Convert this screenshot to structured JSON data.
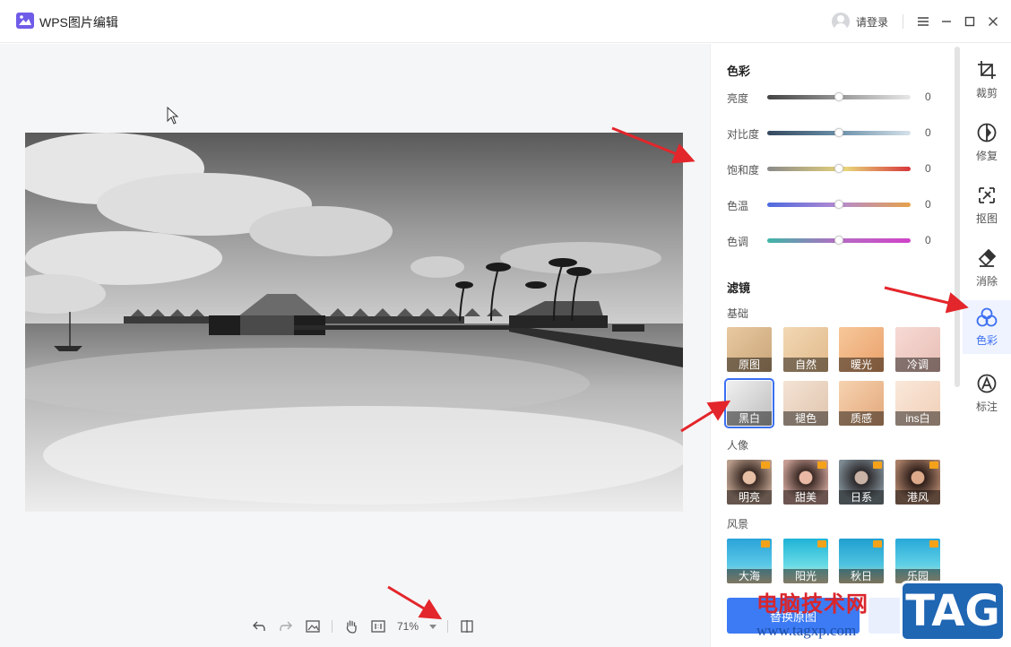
{
  "app": {
    "title": "WPS图片编辑",
    "login": "请登录"
  },
  "adjust": {
    "title": "色彩",
    "rows": [
      {
        "label": "亮度",
        "value": "0"
      },
      {
        "label": "对比度",
        "value": "0"
      },
      {
        "label": "饱和度",
        "value": "0"
      },
      {
        "label": "色温",
        "value": "0"
      },
      {
        "label": "色调",
        "value": "0"
      }
    ]
  },
  "filters": {
    "title": "滤镜",
    "basic": {
      "title": "基础",
      "items": [
        "原图",
        "自然",
        "暖光",
        "冷调",
        "黑白",
        "褪色",
        "质感",
        "ins白"
      ],
      "selected": "黑白"
    },
    "portrait": {
      "title": "人像",
      "items": [
        "明亮",
        "甜美",
        "日系",
        "港风"
      ]
    },
    "landscape": {
      "title": "风景",
      "items": [
        "大海",
        "阳光",
        "秋日",
        "乐园"
      ]
    }
  },
  "apply_button": "替换原图",
  "tools": [
    {
      "label": "裁剪",
      "icon": "crop-icon"
    },
    {
      "label": "修复",
      "icon": "repair-icon"
    },
    {
      "label": "抠图",
      "icon": "cutout-icon"
    },
    {
      "label": "消除",
      "icon": "eraser-icon"
    },
    {
      "label": "色彩",
      "icon": "color-icon",
      "active": true
    },
    {
      "label": "标注",
      "icon": "annotate-icon"
    }
  ],
  "toolbar": {
    "zoom": "71%"
  },
  "watermark": {
    "cn": "电脑技术网",
    "url": "www.tagxp.com",
    "tag": "TAG"
  },
  "colors": {
    "accent": "#3d6ff2",
    "arrow": "#e3262b"
  }
}
